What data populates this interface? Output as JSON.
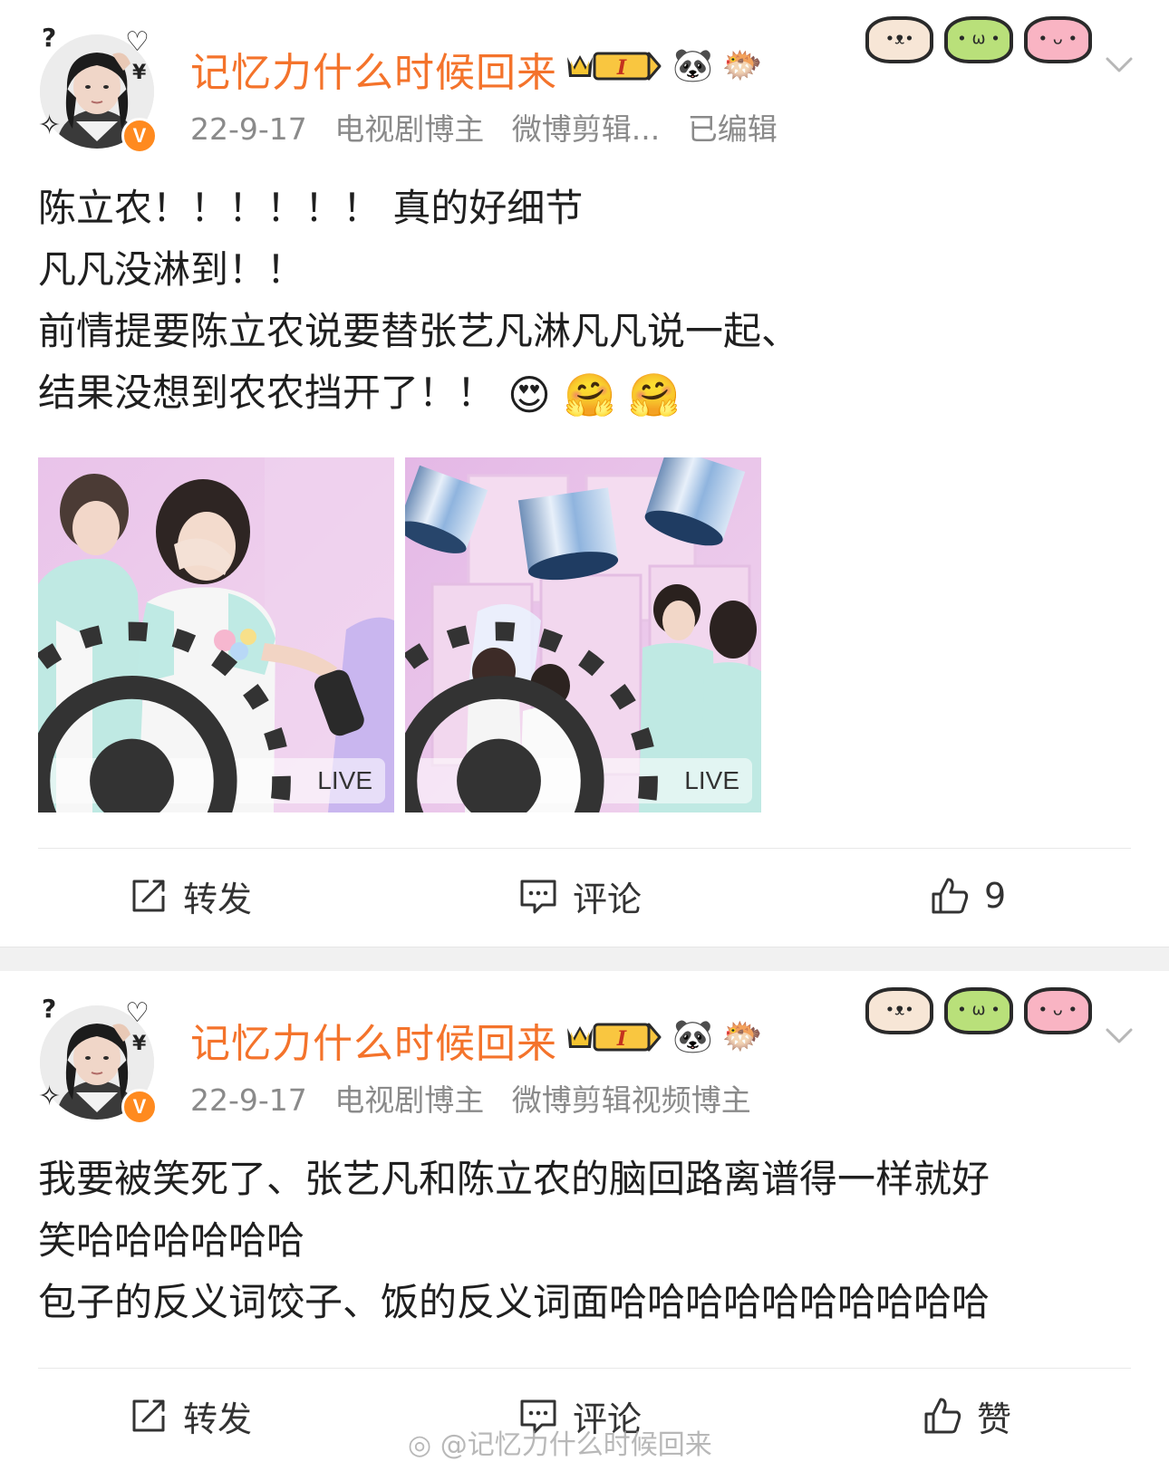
{
  "colors": {
    "username": "#f4732b",
    "meta": "#8a8a8a",
    "verified": "#ff8a1f",
    "separator": "#f1f1f1"
  },
  "posts": [
    {
      "username": "记忆力什么时候回来",
      "member_level": "I",
      "badge_icons": [
        "panda-icon",
        "goldfish-icon"
      ],
      "date": "22-9-17",
      "tags": [
        "电视剧博主",
        "微博剪辑..."
      ],
      "edited": "已编辑",
      "verified_mark": "V",
      "avatar_decorations": [
        "?",
        "♡",
        "¥",
        "✧"
      ],
      "stickers": [
        "pig-face-sticker",
        "frog-face-sticker",
        "pink-pig-sticker"
      ],
      "lines": [
        "陈立农！！！！！！ 真的好细节",
        "凡凡没淋到！！",
        "前情提要陈立农说要替张艺凡淋凡凡说一起、",
        "结果没想到农农挡开了！！"
      ],
      "inline_emojis": [
        "😍",
        "🤗",
        "🤗"
      ],
      "images": [
        {
          "name": "photo-stage-1",
          "live_label": "LIVE"
        },
        {
          "name": "photo-stage-2",
          "live_label": "LIVE"
        }
      ],
      "actions": {
        "repost": "转发",
        "comment": "评论",
        "like": "9"
      }
    },
    {
      "username": "记忆力什么时候回来",
      "member_level": "I",
      "badge_icons": [
        "panda-icon",
        "goldfish-icon"
      ],
      "date": "22-9-17",
      "tags": [
        "电视剧博主",
        "微博剪辑视频博主"
      ],
      "verified_mark": "V",
      "avatar_decorations": [
        "?",
        "♡",
        "¥",
        "✧"
      ],
      "stickers": [
        "pig-face-sticker",
        "frog-face-sticker",
        "pink-pig-sticker"
      ],
      "lines": [
        "我要被笑死了、张艺凡和陈立农的脑回路离谱得一样就好",
        "笑哈哈哈哈哈哈",
        "包子的反义词饺子、饭的反义词面哈哈哈哈哈哈哈哈哈哈"
      ],
      "actions": {
        "repost": "转发",
        "comment": "评论",
        "like": "赞"
      }
    }
  ],
  "watermark": "@记忆力什么时候回来"
}
